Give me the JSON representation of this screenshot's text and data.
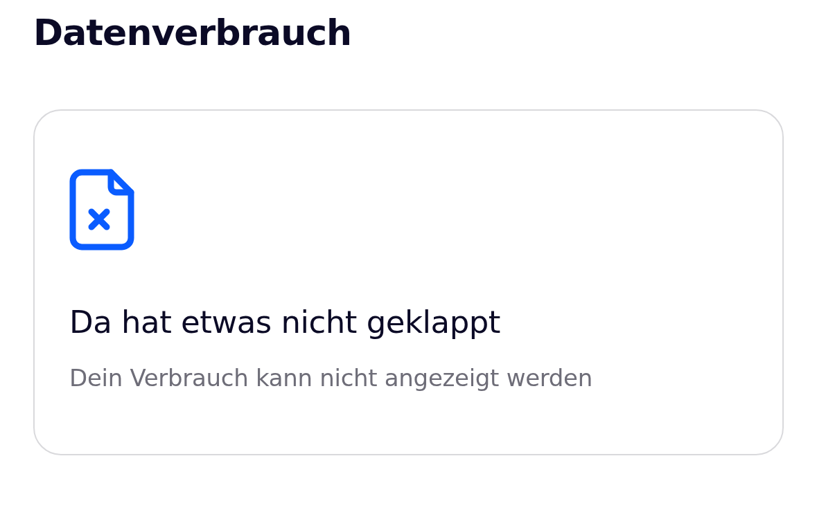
{
  "title": "Datenverbrauch",
  "error_card": {
    "heading": "Da hat etwas nicht geklappt",
    "message": "Dein Verbrauch kann nicht angezeigt werden"
  }
}
